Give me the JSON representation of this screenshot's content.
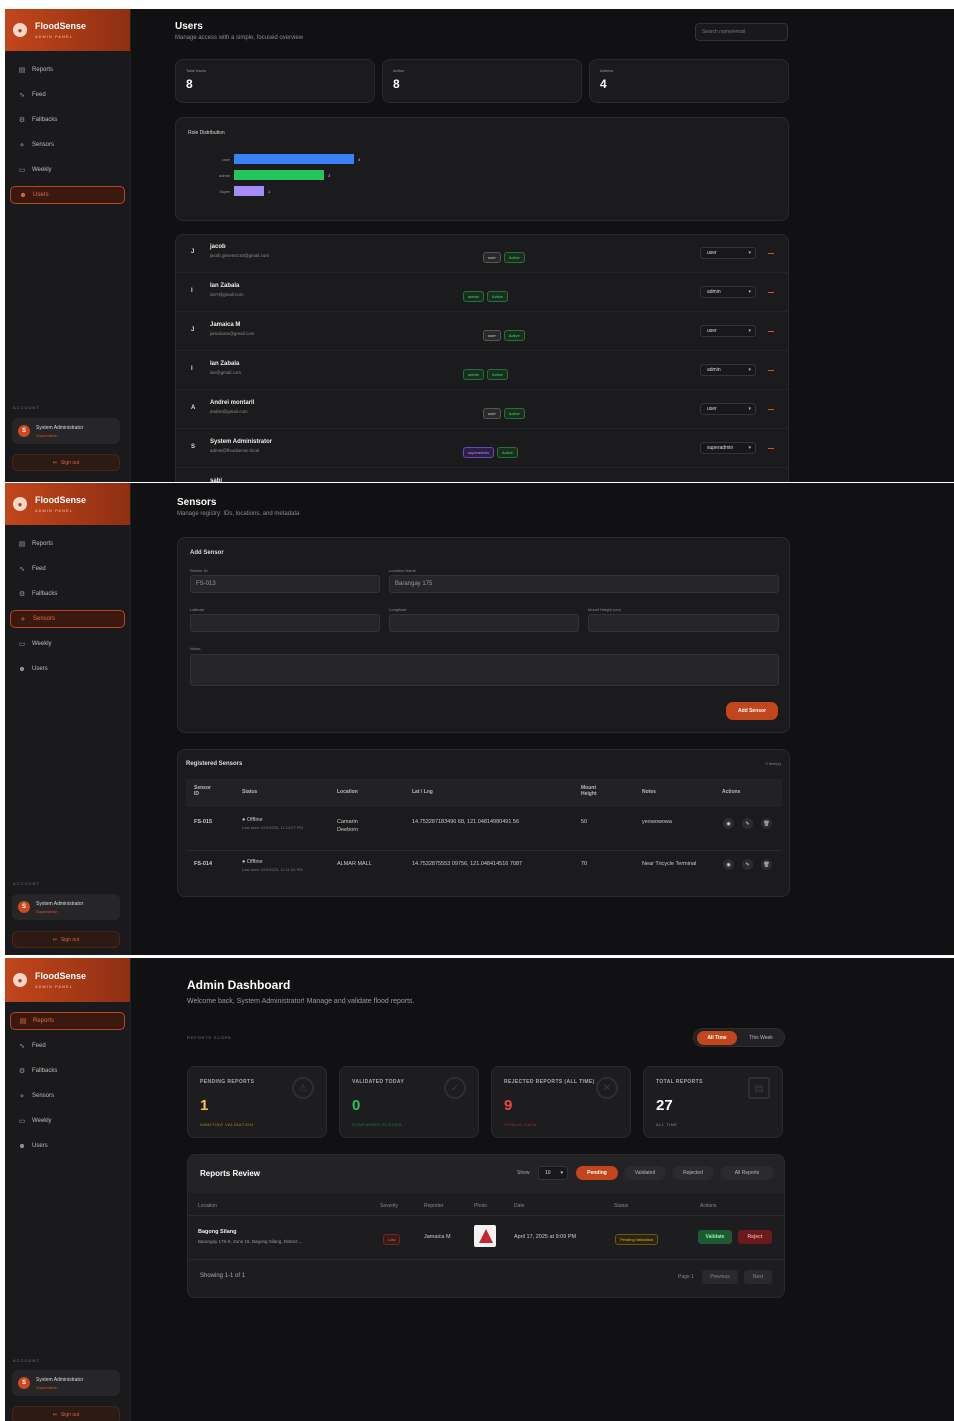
{
  "brand": {
    "name": "FloodSense",
    "tag": "ADMIN PANEL",
    "logo": "drop-icon"
  },
  "nav_items": [
    {
      "label": "Reports",
      "icon": "document-icon"
    },
    {
      "label": "Feed",
      "icon": "activity-icon"
    },
    {
      "label": "Fallbacks",
      "icon": "settings-icon"
    },
    {
      "label": "Sensors",
      "icon": "radio-icon"
    },
    {
      "label": "Weekly",
      "icon": "chart-icon"
    },
    {
      "label": "Users",
      "icon": "users-icon"
    }
  ],
  "account": {
    "section_label": "ACCOUNT",
    "initial": "S",
    "name": "System Administrator",
    "role": "Superadmin",
    "signout": "Sign out"
  },
  "users_page": {
    "title": "Users",
    "subtitle": "Manage access with a simple, focused overview",
    "search_placeholder": "Search name/email",
    "stats": [
      {
        "label": "Total Users",
        "value": "8"
      },
      {
        "label": "Active",
        "value": "8"
      },
      {
        "label": "Admins",
        "value": "4"
      }
    ],
    "chart_title": "Role Distribution",
    "chart_data": {
      "type": "bar",
      "categories": [
        "user",
        "admin",
        "Super"
      ],
      "values": [
        4,
        3,
        1
      ],
      "colors": [
        "#3b82f6",
        "#22c55e",
        "#a78bfa"
      ]
    },
    "users": [
      {
        "initial": "J",
        "name": "jacob",
        "email": "jacob.gimenez10@gmail.com",
        "role_badge": "user",
        "status": "Active",
        "role_select": "user"
      },
      {
        "initial": "I",
        "name": "Ian Zabala",
        "email": "ian7@gmail.com",
        "role_badge": "admin",
        "status": "Active",
        "role_select": "admin"
      },
      {
        "initial": "J",
        "name": "Jamaica M",
        "email": "jamaicam@gmail.com",
        "role_badge": "user",
        "status": "Active",
        "role_select": "user"
      },
      {
        "initial": "I",
        "name": "Ian Zabala",
        "email": "ian@gmail.com",
        "role_badge": "admin",
        "status": "Active",
        "role_select": "admin"
      },
      {
        "initial": "A",
        "name": "Andrei montarll",
        "email": "andrei@gmail.com",
        "role_badge": "user",
        "status": "Active",
        "role_select": "user"
      },
      {
        "initial": "S",
        "name": "System Administrator",
        "email": "admin@floodsense.local",
        "role_badge": "superadmin",
        "status": "Active",
        "role_select": "superadmin"
      },
      {
        "initial": "",
        "name": "sabi",
        "email": "",
        "role_badge": "",
        "status": "",
        "role_select": ""
      }
    ]
  },
  "sensors_page": {
    "title": "Sensors",
    "subtitle": "Manage registry: IDs, locations, and metadata",
    "add_title": "Add Sensor",
    "fields": {
      "sensor_id_label": "Sensor ID",
      "sensor_id_placeholder": "FS-013",
      "location_label": "Location Name",
      "location_placeholder": "Barangay 175",
      "lat_label": "Latitude",
      "lng_label": "Longitude",
      "mount_label": "Mount Height (cm)",
      "notes_label": "Notes"
    },
    "add_button": "Add Sensor",
    "registered_title": "Registered Sensors",
    "registered_count": "2 item(s)",
    "columns": [
      "Sensor ID",
      "Status",
      "Location",
      "Lat / Lng",
      "Mount Height",
      "Notes",
      "Actions"
    ],
    "rows": [
      {
        "id": "FS-015",
        "status": "Offline",
        "status_detail": "Last seen 4/19/2025, 11:14:07 PM",
        "location": "Camarin Deeborn",
        "latlng": "14.753287183496 68, 121.04814980491 56",
        "mount": "50",
        "notes": "yeowowowa"
      },
      {
        "id": "FS-014",
        "status": "Offline",
        "status_detail": "Last seen 4/19/2025, 11:11:02 PM",
        "location": "ALMAR MALL",
        "latlng": "14.7532875553 09756, 121.048414516 7087",
        "mount": "70",
        "notes": "Near Tricycle Terminal"
      }
    ]
  },
  "dashboard_page": {
    "title": "Admin Dashboard",
    "subtitle": "Welcome back, System Administrator! Manage and validate flood reports.",
    "scope_label": "REPORTS SCOPE",
    "scope_tabs": [
      "All Time",
      "This Week"
    ],
    "cards": [
      {
        "label": "PENDING REPORTS",
        "value": "1",
        "sub": "AWAITING VALIDATION",
        "color": "#f5c542",
        "icon": "warning-icon"
      },
      {
        "label": "VALIDATED TODAY",
        "value": "0",
        "sub": "CONFIRMED FLOODS",
        "color": "#22c55e",
        "icon": "check-icon"
      },
      {
        "label": "REJECTED REPORTS (ALL TIME)",
        "value": "9",
        "sub": "INVALID DATA",
        "color": "#ef4444",
        "icon": "x-icon"
      },
      {
        "label": "TOTAL REPORTS",
        "value": "27",
        "sub": "ALL TIME",
        "color": "#ffffff",
        "icon": "document-icon"
      }
    ],
    "review_title": "Reports Review",
    "show_label": "Show",
    "page_size": "10",
    "filter_tabs": [
      "Pending",
      "Validated",
      "Rejected",
      "All Reports"
    ],
    "columns": [
      "Location",
      "Severity",
      "Reporter",
      "Photo",
      "Date",
      "Status",
      "Actions"
    ],
    "rows": [
      {
        "location": "Bagong Silang",
        "address": "Barangay 175-S, Zone 15, Bagong Silang, District ...",
        "severity": "Low",
        "reporter": "Jamaica M",
        "date": "April 17, 2025 at 9:09 PM",
        "status": "Pending Validation",
        "validate": "Validate",
        "reject": "Reject"
      }
    ],
    "showing": "Showing 1-1 of 1",
    "page_label": "Page 1",
    "prev": "Previous",
    "next": "Next"
  }
}
